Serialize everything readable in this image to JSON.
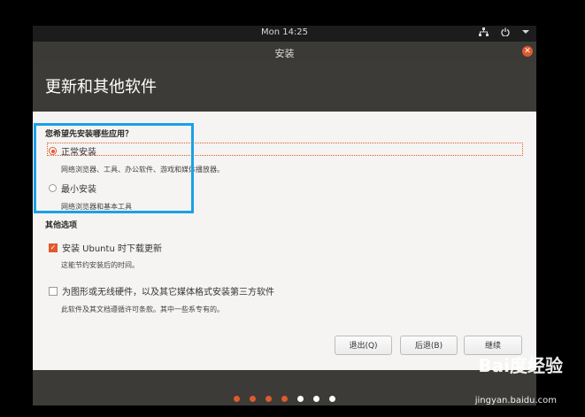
{
  "topbar": {
    "clock": "Mon 14:25",
    "icons": [
      "network-icon",
      "power-icon",
      "menu-arrow-icon"
    ]
  },
  "window": {
    "title": "安装",
    "heading": "更新和其他软件"
  },
  "install_type": {
    "question": "您希望先安装哪些应用？",
    "options": [
      {
        "label": "正常安装",
        "desc": "网络浏览器、工具、办公软件、游戏和媒体播放器。",
        "selected": true
      },
      {
        "label": "最小安装",
        "desc": "网络浏览器和基本工具",
        "selected": false
      }
    ]
  },
  "other_options": {
    "title": "其他选项",
    "items": [
      {
        "label": "安装 Ubuntu 时下载更新",
        "desc": "这能节约安装后的时间。",
        "checked": true
      },
      {
        "label": "为图形或无线硬件，以及其它媒体格式安装第三方软件",
        "desc": "此软件及其文档遵循许可条款。其中一些系专有的。",
        "checked": false
      }
    ]
  },
  "buttons": {
    "quit": "退出(Q)",
    "back": "后退(B)",
    "continue": "继续"
  },
  "progress": {
    "total": 7,
    "completed": 4
  },
  "watermark": {
    "brand": "Bai度经验",
    "url": "jingyan.baidu.com"
  },
  "colors": {
    "accent": "#e05a2d",
    "highlight": "#1aa0e8",
    "header": "#3c3b37"
  }
}
